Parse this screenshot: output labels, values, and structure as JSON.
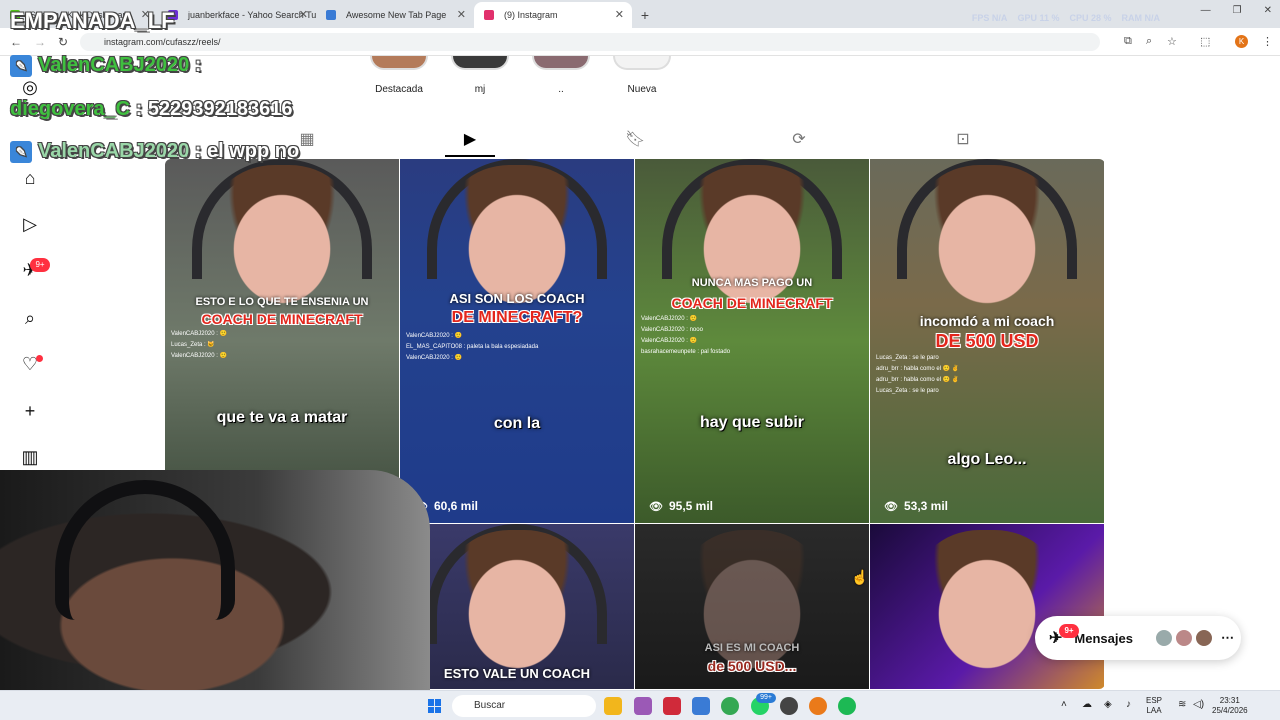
{
  "browser": {
    "tabs": [
      {
        "label": "Stream - Kick Dashboard",
        "color": "#53c41a"
      },
      {
        "label": "juanberkface - Yahoo Search Tu",
        "color": "#6b2fd4"
      },
      {
        "label": "Awesome New Tab Page",
        "color": "#3a7bd5"
      },
      {
        "label": "(9) Instagram",
        "color": "#e1306c"
      }
    ],
    "new_tab": "+",
    "url": "instagram.com/cufaszz/reels/",
    "perf": {
      "fps": "FPS  N/A",
      "gpu": "GPU  11 %",
      "cpu": "CPU  28 %",
      "ram": "RAM  N/A"
    },
    "profile_initial": "K"
  },
  "instagram": {
    "sidebar": {
      "messages_badge": "9+"
    },
    "highlights": [
      {
        "label": "Destacada"
      },
      {
        "label": "mj"
      },
      {
        "label": ".."
      },
      {
        "label": "Nueva"
      }
    ],
    "reels": [
      {
        "top": "ESTO E LO QUE TE ENSENIA UN",
        "red": "COACH DE MINECRAFT",
        "mid": "que te va a matar",
        "views": "",
        "chat": [
          "ValenCABJ2020 : 🙂",
          "Lucas_Zeta : 🐱",
          "ValenCABJ2020 : 🙂"
        ]
      },
      {
        "top": "ASI SON LOS COACH",
        "red": "DE MINECRAFT?",
        "mid": "con la",
        "views": "60,6 mil",
        "chat": [
          "ValenCABJ2020 : 🙂",
          "EL_MAS_CAPITO08 : paleta la bala espesiadada",
          "ValenCABJ2020 : 🙂"
        ]
      },
      {
        "top": "NUNCA MAS PAGO UN",
        "red": "COACH DE MINECRAFT",
        "mid": "hay que subir",
        "views": "95,5 mil",
        "chat": [
          "ValenCABJ2020 : 🙂",
          "ValenCABJ2020 : nooo",
          "ValenCABJ2020 : 🙂",
          "basrahacemeunpete : pal fostado"
        ]
      },
      {
        "top": "incomdó a mi coach",
        "red": "DE 500 USD",
        "mid": "algo Leo...",
        "views": "53,3 mil",
        "chat": [
          "Lucas_Zeta : se le paro",
          "adru_brr : habla como el 🙂 ✌",
          "adru_brr : habla como el 🙂 ✌",
          "Lucas_Zeta : se le paro"
        ]
      },
      {
        "top": "",
        "red": "",
        "mid": "",
        "views": "",
        "chat": []
      },
      {
        "top": "ESTO VALE UN COACH",
        "red": "",
        "mid": "",
        "views": "",
        "chat": []
      },
      {
        "top": "ASI ES MI COACH",
        "red": "de 500 USD...",
        "mid": "",
        "views": "",
        "chat": []
      },
      {
        "top": "",
        "red": "",
        "mid": "",
        "views": "",
        "chat": []
      }
    ],
    "messages_label": "Mensajes",
    "messages_badge": "9+"
  },
  "overlay": {
    "streamer": "EMPANADA_LF",
    "chat": [
      {
        "user": "ValenCABJ2020",
        "text": " :"
      },
      {
        "user": "diegovera_C",
        "text": " : 5229392183616"
      },
      {
        "user": "ValenCABJ2020",
        "text": " : el wpp no"
      }
    ]
  },
  "taskbar": {
    "search_placeholder": "Buscar",
    "lang_top": "ESP",
    "lang_bottom": "LAA",
    "time": "23:31",
    "date": "25/4/2026",
    "whatsapp_badge": "99+"
  }
}
